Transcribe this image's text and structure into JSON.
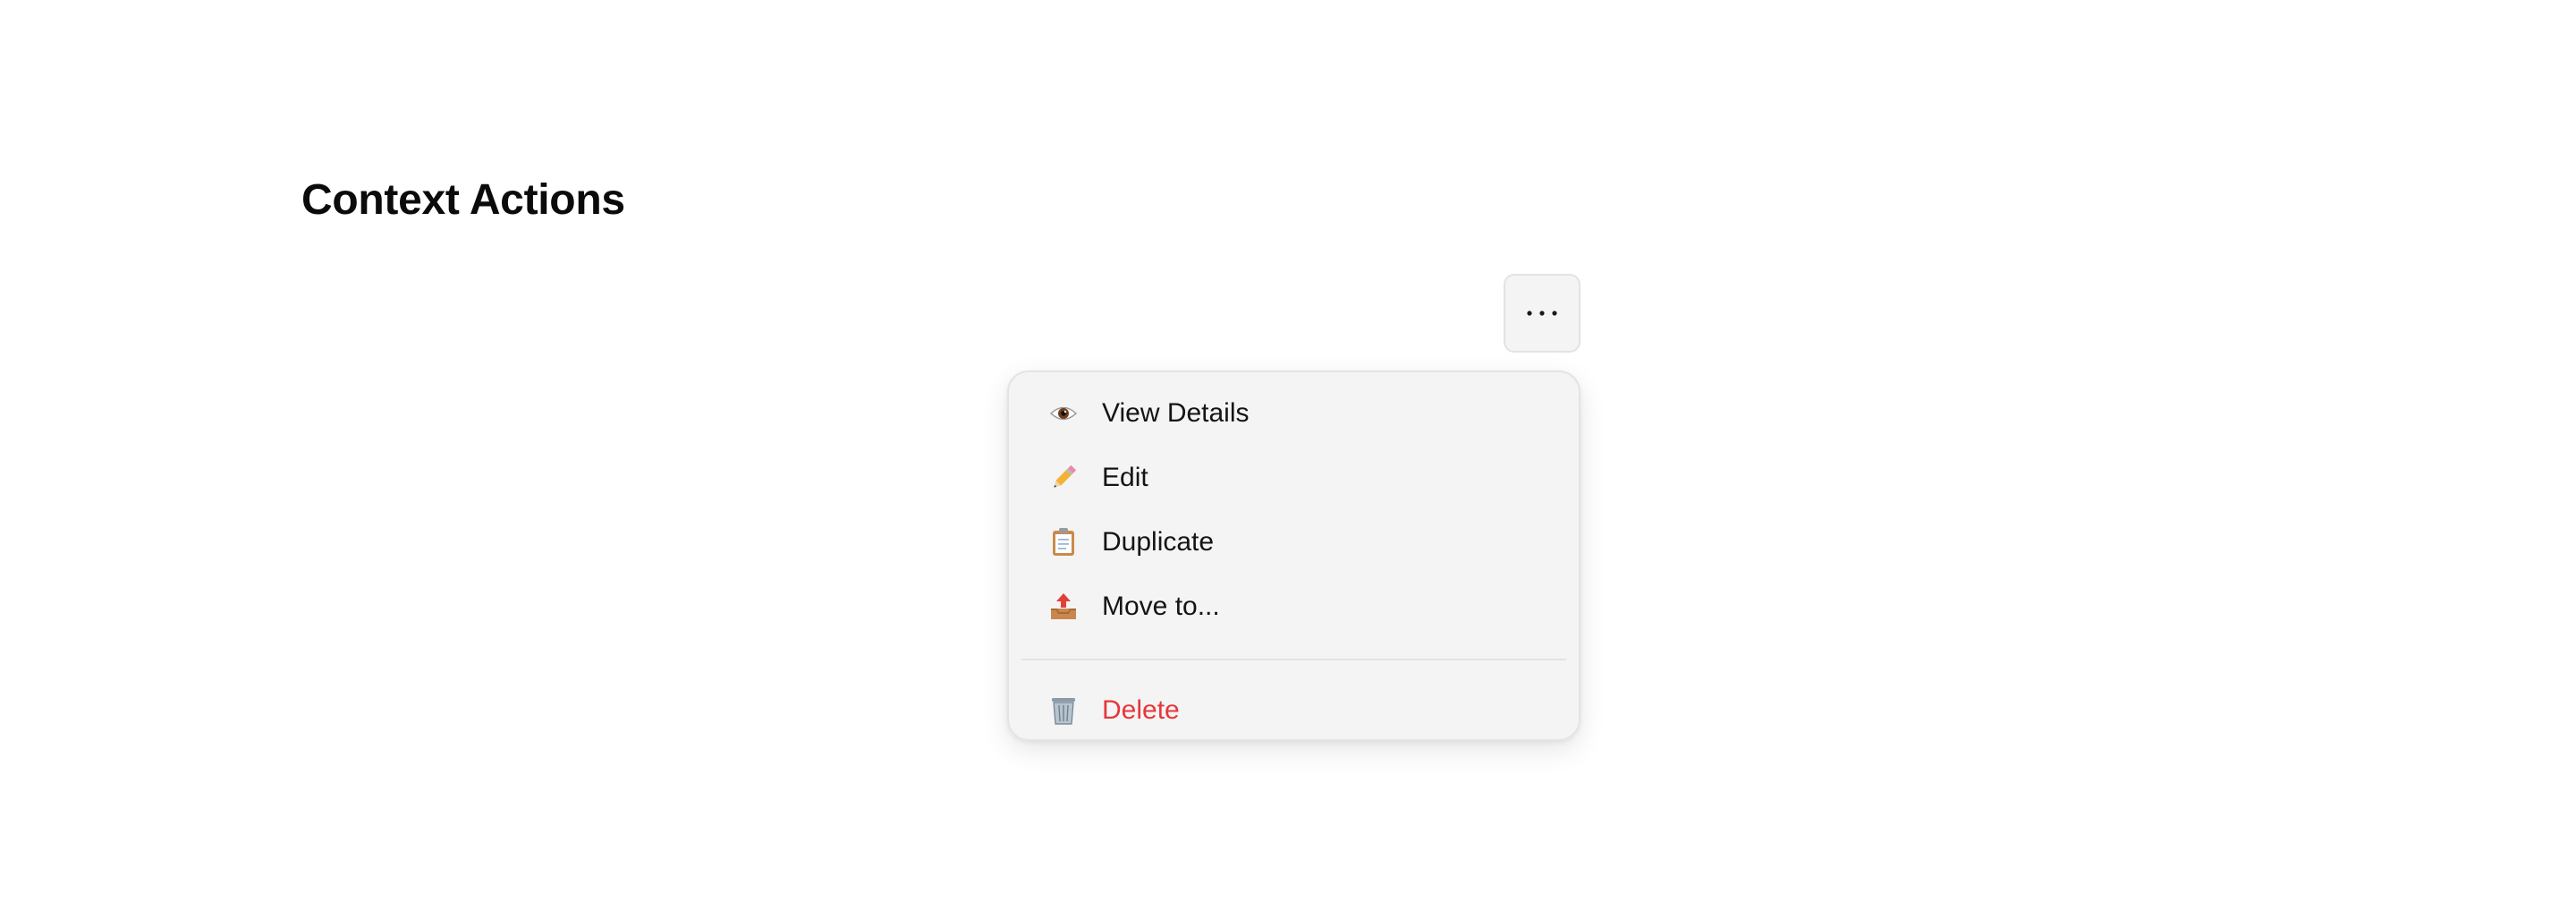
{
  "page": {
    "title": "Context Actions"
  },
  "trigger": {
    "icon": "ellipsis-icon"
  },
  "menu": {
    "items": [
      {
        "label": "View Details",
        "icon": "eye-icon"
      },
      {
        "label": "Edit",
        "icon": "pencil-icon"
      },
      {
        "label": "Duplicate",
        "icon": "clipboard-icon"
      },
      {
        "label": "Move to...",
        "icon": "outbox-tray-icon"
      }
    ],
    "danger_item": {
      "label": "Delete",
      "icon": "wastebasket-icon"
    }
  },
  "colors": {
    "danger": "#e5383b",
    "menu_background": "#f4f4f4",
    "text": "#141414"
  }
}
